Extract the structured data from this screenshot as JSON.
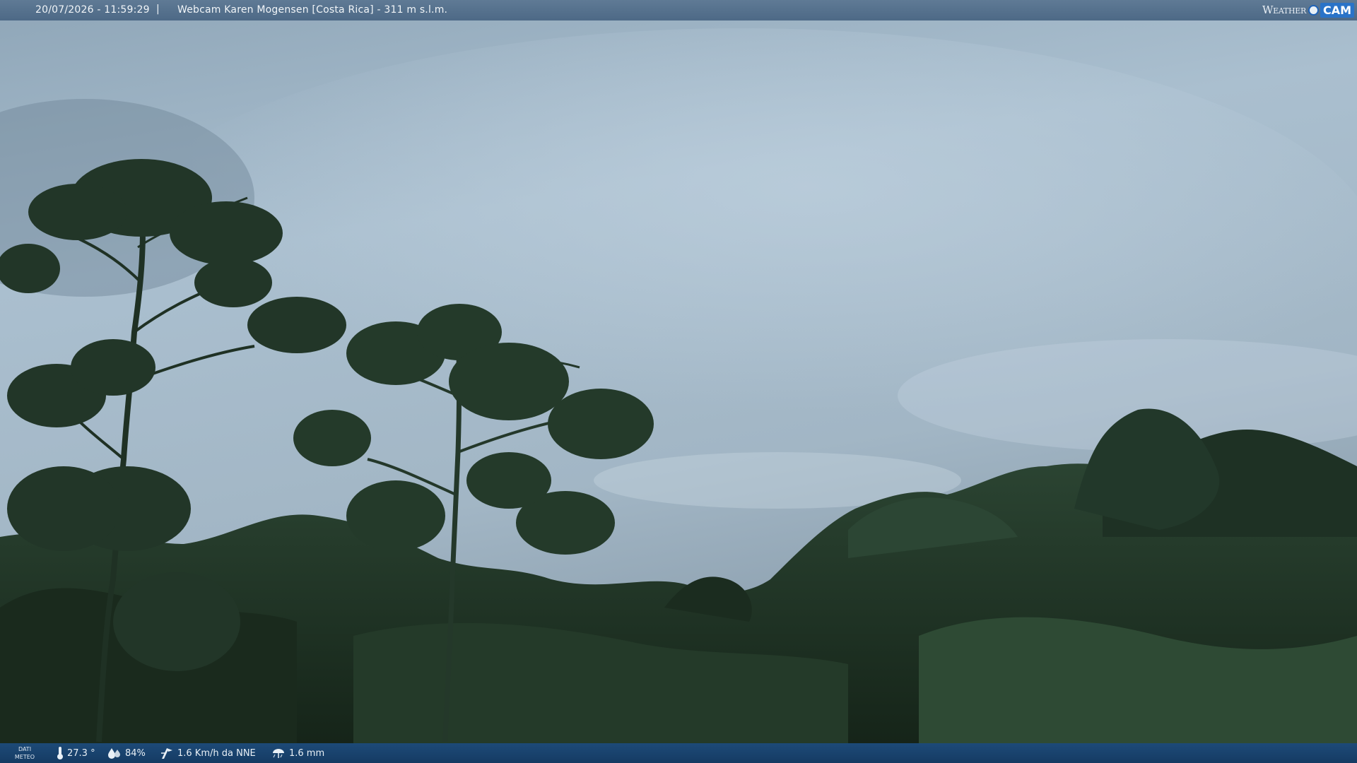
{
  "header": {
    "datetime": "20/07/2026 - 11:59:29",
    "separator": "|",
    "title": "Webcam Karen Mogensen [Costa Rica]  - 311 m s.l.m.",
    "logo_word": "Weather",
    "logo_cam": "CAM"
  },
  "footer": {
    "dati_line1": "DATI",
    "dati_line2": "METEO",
    "temperature": "27.3 °",
    "humidity": "84%",
    "wind": "1.6 Km/h da NNE",
    "rain": "1.6 mm",
    "icons": [
      "thermometer-icon",
      "humidity-icon",
      "wind-icon",
      "rain-icon"
    ]
  },
  "colors": {
    "sky_top": "#9fb4c5",
    "sky_mid": "#aec2d2",
    "foliage_dark": "#17261c",
    "foliage": "#24392a",
    "topbar": "#587490",
    "bottombar": "#1b4470"
  }
}
